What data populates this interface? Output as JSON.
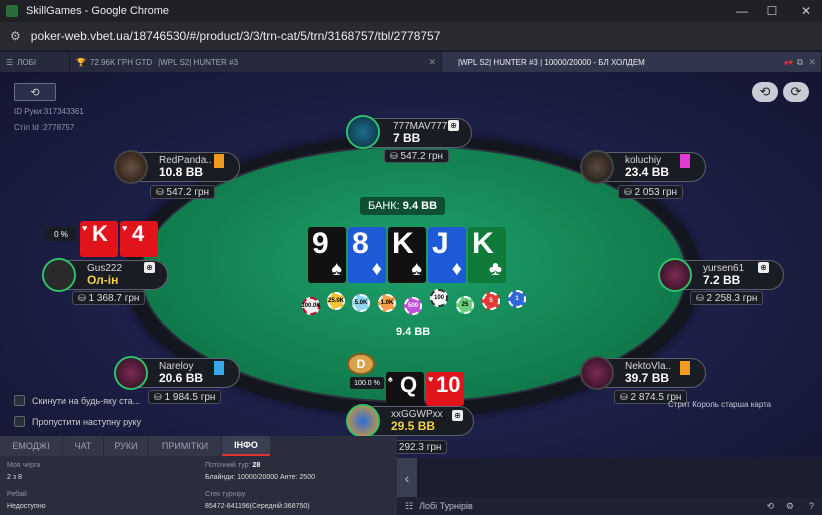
{
  "window": {
    "title": "SkillGames - Google Chrome",
    "url": "poker-web.vbet.ua/18746530/#/product/3/3/trn-cat/5/trn/3168757/tbl/2778757",
    "minimize": "—",
    "maximize": "☐",
    "close": "✕"
  },
  "tabs": {
    "lobby": "ЛОБІ",
    "tournament": "72.96K ГРН GTD",
    "tournament_sub": "|WPL S2| HUNTER #3",
    "game": "|WPL S2| HUNTER #3 | 10000/20000 - БЛ ХОЛДЕМ"
  },
  "table": {
    "hand_id": "ID Руки:317343361",
    "table_id": "Стіл Id :2778757",
    "pot_label": "БАНК:",
    "pot_value": "9.4 BB",
    "pot_below": "9.4 BB",
    "dealer": "D",
    "showdown_text": "Стрит Король старша карта"
  },
  "board": [
    {
      "rank": "9",
      "suit": "♠",
      "color": "#111111"
    },
    {
      "rank": "8",
      "suit": "♦",
      "color": "#1d5bd6"
    },
    {
      "rank": "K",
      "suit": "♠",
      "color": "#111111"
    },
    {
      "rank": "J",
      "suit": "♦",
      "color": "#1d5bd6"
    },
    {
      "rank": "K",
      "suit": "♣",
      "color": "#0f7a3a"
    }
  ],
  "chips": [
    "100.0K",
    "25.0K",
    "5.0K",
    "1.0K",
    "500",
    "100",
    "25",
    "5",
    "1"
  ],
  "players": {
    "top": {
      "name": "777MAV777",
      "stack": "7 BB",
      "chips": "547.2 грн"
    },
    "top_left": {
      "name": "RedPanda..",
      "stack": "10.8 BB",
      "chips": "547.2 грн"
    },
    "top_right": {
      "name": "koluchiy",
      "stack": "23.4 BB",
      "chips": "2 053 грн"
    },
    "left": {
      "name": "Gus222",
      "stack": "Ол-ін",
      "chips": "1 368.7 грн",
      "equity": "0 %",
      "cards": [
        {
          "rank": "K",
          "suit": "♥"
        },
        {
          "rank": "4",
          "suit": "♥"
        }
      ]
    },
    "right": {
      "name": "yursen61",
      "stack": "7.2 BB",
      "chips": "2 258.3 грн"
    },
    "bottom_left": {
      "name": "Nareloy",
      "stack": "20.6 BB",
      "chips": "1 984.5 грн"
    },
    "bottom_right": {
      "name": "NektoVla..",
      "stack": "39.7 BB",
      "chips": "2 874.5 грн"
    },
    "hero": {
      "name": "xxGGWPxx",
      "stack": "29.5 BB",
      "chips": "2 292.3 грн",
      "equity": "100.0 %",
      "cards": [
        {
          "rank": "Q",
          "suit": "♠"
        },
        {
          "rank": "10",
          "suit": "♥"
        }
      ]
    }
  },
  "options": {
    "fold_any": "Скинути на будь-яку ста...",
    "skip_hand": "Пропустити наступну руку"
  },
  "bottom_tabs": [
    "ЕМОДЖІ",
    "ЧАТ",
    "РУКИ",
    "ПРИМІТКИ",
    "ІНФО"
  ],
  "info": {
    "my_turn_label": "Моя черга",
    "my_turn_value": "2 з 8",
    "current_round_label": "Поточний тур:",
    "current_round_value": "28",
    "blinds": "Блайнди: 10000/20000 Анте: 2500",
    "rebuy_label": "Ребай",
    "rebuy_value": "Недоступно",
    "stack_label": "Стек турніру",
    "stack_value": "85472-841196(Середній:368750)"
  },
  "footer": {
    "lobby_tournaments": "Лобі Турнірів"
  }
}
